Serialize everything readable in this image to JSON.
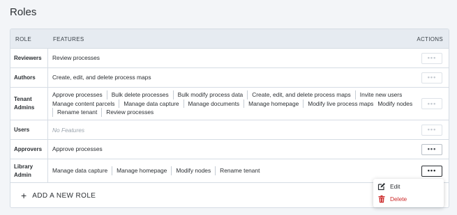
{
  "page": {
    "title": "Roles"
  },
  "table": {
    "headers": {
      "role": "ROLE",
      "features": "FEATURES",
      "actions": "ACTIONS"
    },
    "rows": [
      {
        "role": "Reviewers",
        "features": [
          "Review processes"
        ]
      },
      {
        "role": "Authors",
        "features": [
          "Create, edit, and delete process maps"
        ]
      },
      {
        "role": "Tenant Admins",
        "features": [
          "Approve processes",
          "Bulk delete processes",
          "Bulk modify process data",
          "Create, edit, and delete process maps",
          "Invite new users",
          "Manage content parcels",
          "Manage data capture",
          "Manage documents",
          "Manage homepage",
          "Modify live process maps",
          "Modify nodes",
          "Rename tenant",
          "Review processes"
        ]
      },
      {
        "role": "Users",
        "features": [],
        "empty_text": "No Features"
      },
      {
        "role": "Approvers",
        "features": [
          "Approve processes"
        ]
      },
      {
        "role": "Library Admin",
        "features": [
          "Manage data capture",
          "Manage homepage",
          "Modify nodes",
          "Rename tenant"
        ]
      }
    ],
    "add_role_label": "ADD A NEW ROLE"
  },
  "context_menu": {
    "items": [
      {
        "label": "Edit",
        "icon": "edit-icon",
        "color": "#2b2f33"
      },
      {
        "label": "Delete",
        "icon": "trash-icon",
        "color": "#cc2a2a"
      }
    ]
  },
  "actions_button": {
    "glyph": "•••"
  }
}
